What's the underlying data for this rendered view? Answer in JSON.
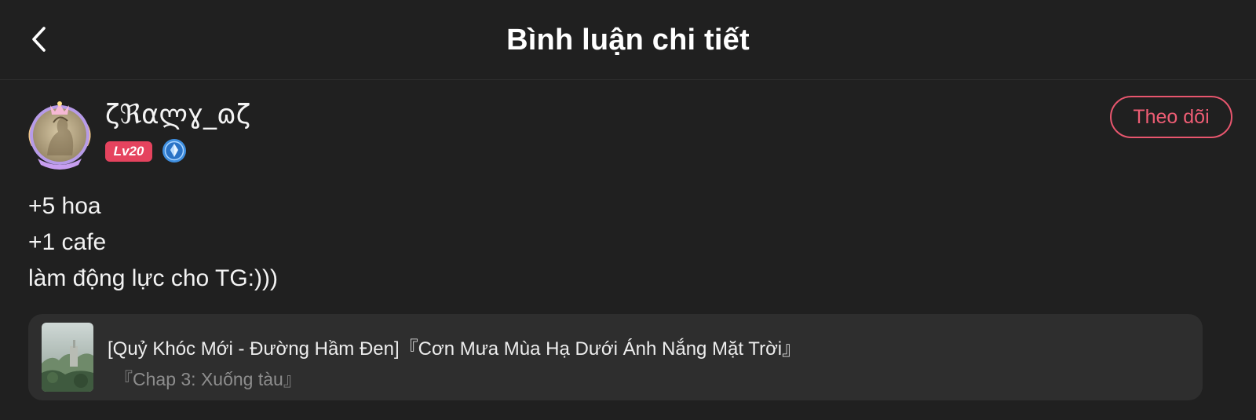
{
  "header": {
    "title": "Bình luận chi tiết",
    "back_icon": "chevron-left-icon"
  },
  "author": {
    "username": "ζℜαლɣ_ɷζ",
    "level_badge": "Lv20",
    "vip_icon": "diamond-badge-icon",
    "follow_label": "Theo dõi",
    "accent_color": "#e5435e"
  },
  "comment": {
    "lines": [
      "+5 hoa",
      "+1 cafe",
      "làm động lực cho TG:)))"
    ]
  },
  "reference": {
    "title": "[Quỷ Khóc Mới - Đường Hầm Đen]『Cơn Mưa Mùa Hạ Dưới Ánh Nắng Mặt Trời』",
    "chapter": "『Chap 3: Xuống tàu』"
  }
}
